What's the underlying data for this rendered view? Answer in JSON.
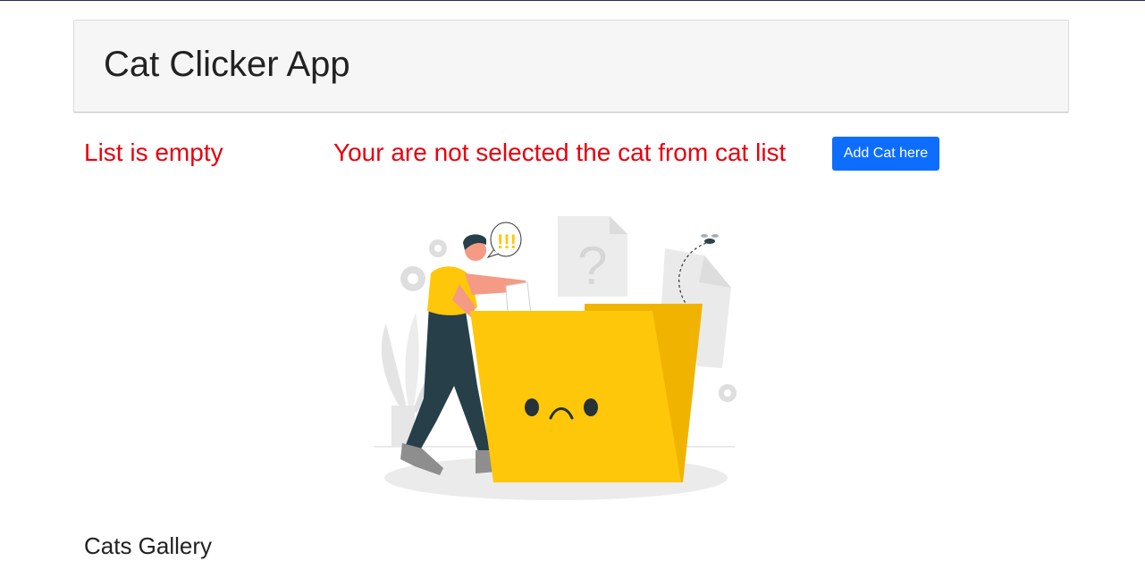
{
  "header": {
    "title": "Cat Clicker App"
  },
  "status": {
    "list_message": "List is empty",
    "selection_message": "Your are not selected the cat from cat list"
  },
  "actions": {
    "add_cat_label": "Add Cat here"
  },
  "illustration": {
    "alert_text": "!!!",
    "question_mark": "?",
    "icon": "empty-folder-illustration"
  },
  "gallery": {
    "title": "Cats Gallery"
  },
  "colors": {
    "message_red": "#e8000e",
    "button_blue": "#0d6efd",
    "folder_yellow": "#ffc709",
    "header_bg": "#f6f6f6"
  }
}
